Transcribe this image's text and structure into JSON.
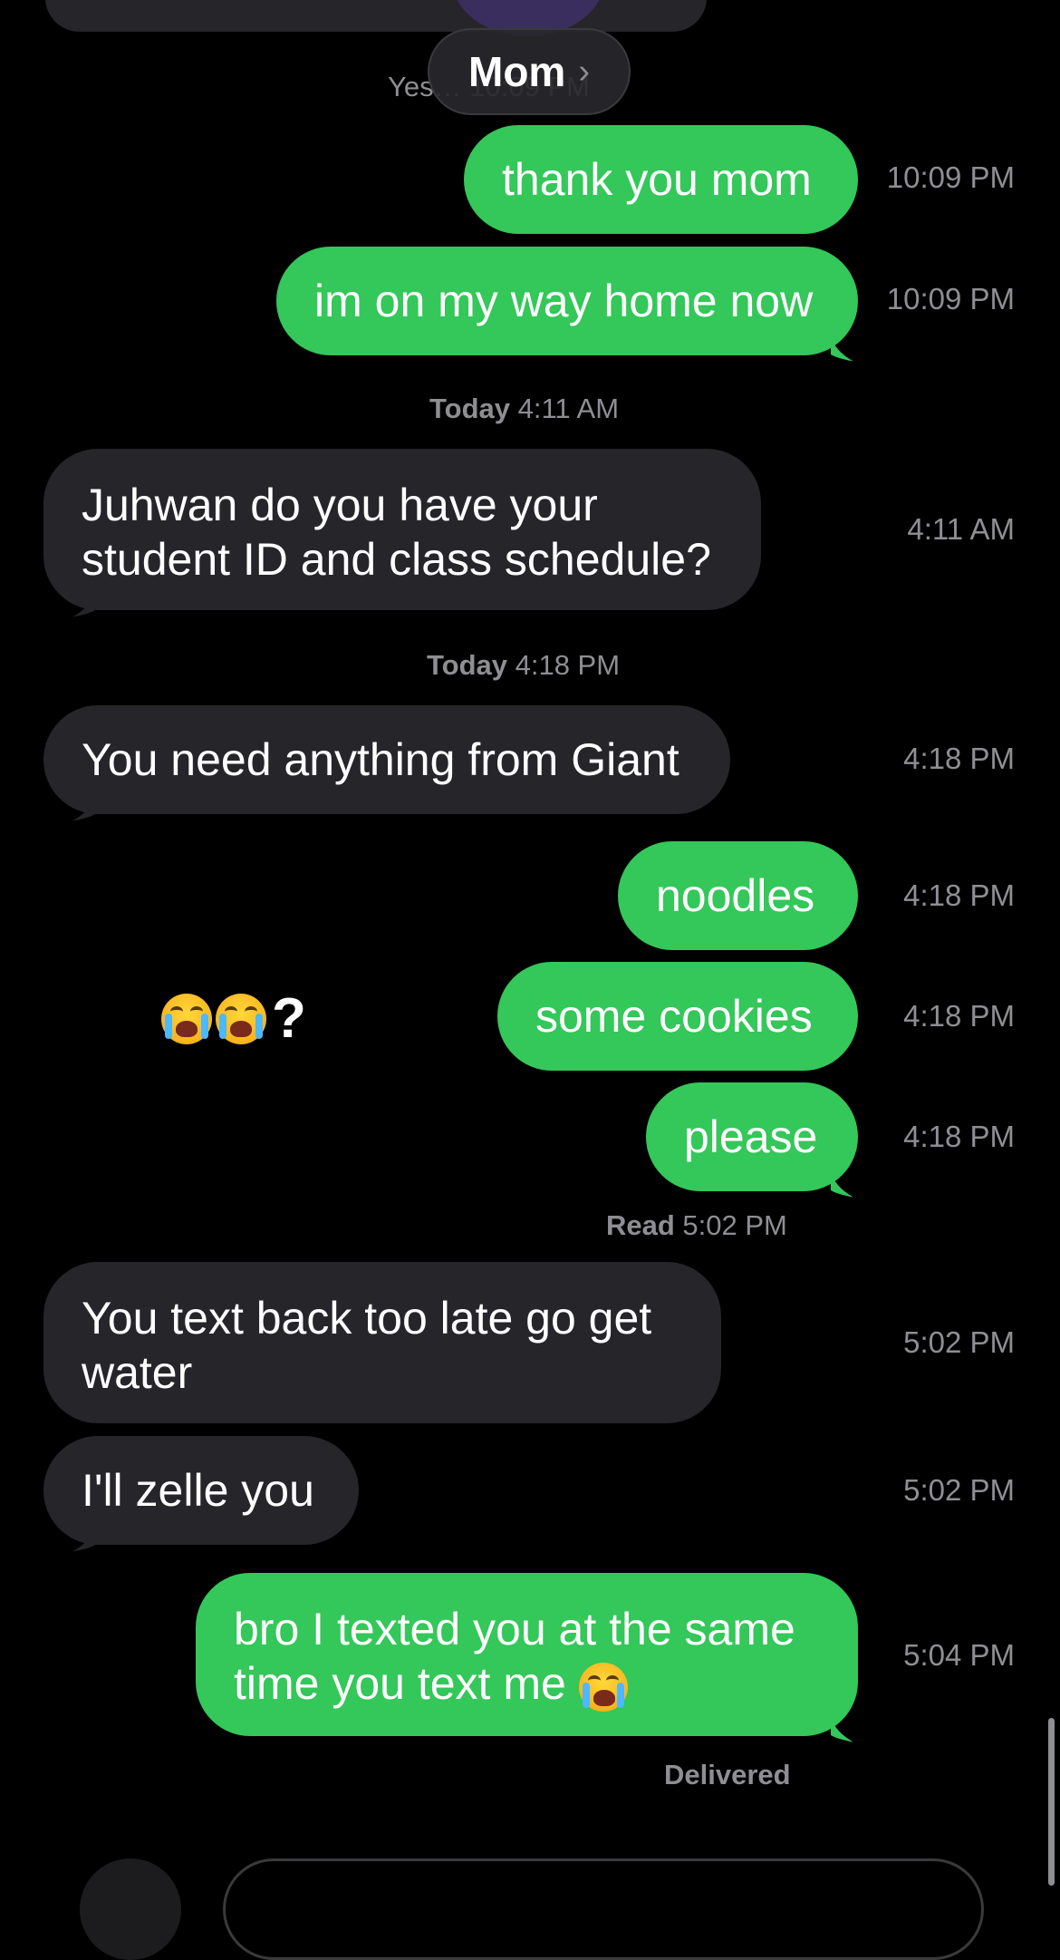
{
  "header": {
    "contact_name": "Mom",
    "chevron": "chevron-right-icon",
    "behind_timestamp": "Yes… 10:09 PM"
  },
  "messages": [
    {
      "id": "m1",
      "dir": "out",
      "text": "thank you mom",
      "time": "10:09 PM"
    },
    {
      "id": "m2",
      "dir": "out",
      "text": "im on my way home now",
      "time": "10:09 PM"
    },
    {
      "id": "m3",
      "dir": "in",
      "lines": [
        "Juhwan do you have your",
        "student ID and class schedule?"
      ],
      "time": "4:11 AM"
    },
    {
      "id": "m4",
      "dir": "in",
      "text": "You need anything from Giant",
      "time": "4:18 PM"
    },
    {
      "id": "m5",
      "dir": "out",
      "text": "noodles",
      "time": "4:18 PM"
    },
    {
      "id": "m6",
      "dir": "out",
      "text": "some cookies",
      "time": "4:18 PM"
    },
    {
      "id": "m7",
      "dir": "out",
      "text": "please",
      "time": "4:18 PM"
    },
    {
      "id": "m8",
      "dir": "in",
      "lines": [
        "You text back too late go get",
        "water"
      ],
      "time": "5:02 PM"
    },
    {
      "id": "m9",
      "dir": "in",
      "text": "I'll zelle you",
      "time": "5:02 PM"
    },
    {
      "id": "m10",
      "dir": "out",
      "lines": [
        "bro I texted you at the same",
        "time you text me"
      ],
      "time": "5:04 PM"
    }
  ],
  "separators": {
    "sep1": {
      "bold": "Today",
      "rest": " 4:11 AM"
    },
    "sep2": {
      "bold": "Today",
      "rest": " 4:18 PM"
    }
  },
  "read_receipt": {
    "bold": "Read",
    "rest": " 5:02 PM"
  },
  "delivered": "Delivered",
  "reaction": {
    "suffix": "?"
  },
  "colors": {
    "outgoing": "#34c759",
    "incoming": "#26252a",
    "meta": "#8e8e93",
    "background": "#000000"
  }
}
